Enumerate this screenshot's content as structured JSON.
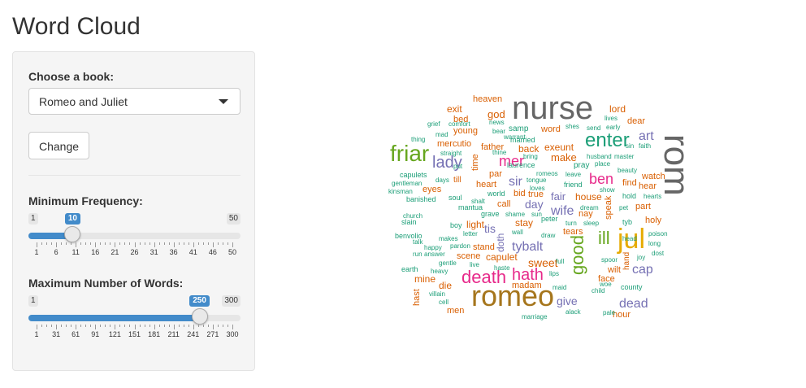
{
  "page_title": "Word Cloud",
  "sidebar": {
    "book_label": "Choose a book:",
    "book_selected": "Romeo and Juliet",
    "change_button": "Change",
    "min_freq": {
      "label": "Minimum Frequency:",
      "min": "1",
      "max": "50",
      "value": "10",
      "fraction": 0.184,
      "ticks": [
        "1",
        "6",
        "11",
        "16",
        "21",
        "26",
        "31",
        "36",
        "41",
        "46",
        "50"
      ]
    },
    "max_words": {
      "label": "Maximum Number of Words:",
      "min": "1",
      "max": "300",
      "value": "250",
      "fraction": 0.833,
      "ticks": [
        "1",
        "31",
        "61",
        "91",
        "121",
        "151",
        "181",
        "211",
        "241",
        "271",
        "300"
      ]
    }
  },
  "colors": {
    "accent": "#428bca",
    "grey": "#666666",
    "olive": "#66a61e",
    "orange": "#d95f02",
    "teal": "#1b9e77",
    "purple": "#7570b3",
    "magenta": "#e7298a",
    "gold": "#a6761d",
    "yellow": "#e6ab02"
  },
  "cloud_words": [
    {
      "t": "nurse",
      "s": 40,
      "c": "#666666"
    },
    {
      "t": "rom",
      "s": 44,
      "c": "#666666",
      "r": 90
    },
    {
      "t": "romeo",
      "s": 36,
      "c": "#a6761d"
    },
    {
      "t": "friar",
      "s": 28,
      "c": "#66a61e"
    },
    {
      "t": "enter",
      "s": 24,
      "c": "#1b9e77"
    },
    {
      "t": "jul",
      "s": 34,
      "c": "#e6ab02"
    },
    {
      "t": "death",
      "s": 22,
      "c": "#e7298a"
    },
    {
      "t": "lady",
      "s": 20,
      "c": "#7570b3"
    },
    {
      "t": "mer",
      "s": 18,
      "c": "#e7298a"
    },
    {
      "t": "good",
      "s": 22,
      "c": "#66a61e",
      "r": -90
    },
    {
      "t": "ill",
      "s": 22,
      "c": "#66a61e"
    },
    {
      "t": "hath",
      "s": 20,
      "c": "#e7298a"
    },
    {
      "t": "ben",
      "s": 18,
      "c": "#e7298a"
    },
    {
      "t": "art",
      "s": 16,
      "c": "#7570b3"
    },
    {
      "t": "sir",
      "s": 16,
      "c": "#7570b3"
    },
    {
      "t": "tybalt",
      "s": 16,
      "c": "#7570b3"
    },
    {
      "t": "wife",
      "s": 16,
      "c": "#7570b3"
    },
    {
      "t": "give",
      "s": 14,
      "c": "#7570b3"
    },
    {
      "t": "dead",
      "s": 16,
      "c": "#7570b3"
    },
    {
      "t": "cap",
      "s": 16,
      "c": "#7570b3"
    },
    {
      "t": "sweet",
      "s": 14,
      "c": "#d95f02"
    },
    {
      "t": "lord",
      "s": 12,
      "c": "#d95f02"
    },
    {
      "t": "dear",
      "s": 11,
      "c": "#d95f02"
    },
    {
      "t": "god",
      "s": 13,
      "c": "#d95f02"
    },
    {
      "t": "exit",
      "s": 12,
      "c": "#d95f02"
    },
    {
      "t": "heaven",
      "s": 11,
      "c": "#d95f02"
    },
    {
      "t": "bed",
      "s": 11,
      "c": "#d95f02"
    },
    {
      "t": "young",
      "s": 11,
      "c": "#d95f02"
    },
    {
      "t": "word",
      "s": 11,
      "c": "#d95f02"
    },
    {
      "t": "exeunt",
      "s": 12,
      "c": "#d95f02"
    },
    {
      "t": "make",
      "s": 13,
      "c": "#d95f02"
    },
    {
      "t": "back",
      "s": 12,
      "c": "#d95f02"
    },
    {
      "t": "father",
      "s": 11,
      "c": "#d95f02"
    },
    {
      "t": "mercutio",
      "s": 11,
      "c": "#d95f02"
    },
    {
      "t": "time",
      "s": 11,
      "c": "#d95f02",
      "r": -90
    },
    {
      "t": "heart",
      "s": 11,
      "c": "#d95f02"
    },
    {
      "t": "par",
      "s": 11,
      "c": "#d95f02"
    },
    {
      "t": "eyes",
      "s": 11,
      "c": "#d95f02"
    },
    {
      "t": "day",
      "s": 14,
      "c": "#7570b3"
    },
    {
      "t": "fair",
      "s": 13,
      "c": "#7570b3"
    },
    {
      "t": "house",
      "s": 12,
      "c": "#d95f02"
    },
    {
      "t": "call",
      "s": 11,
      "c": "#d95f02"
    },
    {
      "t": "stay",
      "s": 12,
      "c": "#d95f02"
    },
    {
      "t": "light",
      "s": 12,
      "c": "#d95f02"
    },
    {
      "t": "stand",
      "s": 11,
      "c": "#d95f02"
    },
    {
      "t": "capulet",
      "s": 12,
      "c": "#d95f02"
    },
    {
      "t": "scene",
      "s": 11,
      "c": "#d95f02"
    },
    {
      "t": "mine",
      "s": 12,
      "c": "#d95f02"
    },
    {
      "t": "die",
      "s": 12,
      "c": "#d95f02"
    },
    {
      "t": "men",
      "s": 11,
      "c": "#d95f02"
    },
    {
      "t": "madam",
      "s": 11,
      "c": "#d95f02"
    },
    {
      "t": "watch",
      "s": 11,
      "c": "#d95f02"
    },
    {
      "t": "hear",
      "s": 11,
      "c": "#d95f02"
    },
    {
      "t": "find",
      "s": 11,
      "c": "#d95f02"
    },
    {
      "t": "part",
      "s": 11,
      "c": "#d95f02"
    },
    {
      "t": "holy",
      "s": 11,
      "c": "#d95f02"
    },
    {
      "t": "wilt",
      "s": 11,
      "c": "#d95f02"
    },
    {
      "t": "face",
      "s": 11,
      "c": "#d95f02"
    },
    {
      "t": "hour",
      "s": 11,
      "c": "#d95f02"
    },
    {
      "t": "hast",
      "s": 11,
      "c": "#d95f02",
      "r": -90
    },
    {
      "t": "tears",
      "s": 11,
      "c": "#d95f02"
    },
    {
      "t": "true",
      "s": 11,
      "c": "#d95f02"
    },
    {
      "t": "bid",
      "s": 11,
      "c": "#d95f02"
    },
    {
      "t": "till",
      "s": 10,
      "c": "#d95f02"
    },
    {
      "t": "tis",
      "s": 14,
      "c": "#7570b3"
    },
    {
      "t": "doth",
      "s": 12,
      "c": "#7570b3",
      "r": -90
    },
    {
      "t": "nay",
      "s": 11,
      "c": "#d95f02"
    },
    {
      "t": "speak",
      "s": 11,
      "c": "#d95f02",
      "r": -90
    },
    {
      "t": "hand",
      "s": 10,
      "c": "#d95f02",
      "r": -90
    },
    {
      "t": "samp",
      "s": 10,
      "c": "#1b9e77"
    },
    {
      "t": "shes",
      "s": 8,
      "c": "#1b9e77"
    },
    {
      "t": "grief",
      "s": 8,
      "c": "#1b9e77"
    },
    {
      "t": "comfort",
      "s": 8,
      "c": "#1b9e77"
    },
    {
      "t": "mad",
      "s": 8,
      "c": "#1b9e77"
    },
    {
      "t": "thing",
      "s": 8,
      "c": "#1b9e77"
    },
    {
      "t": "married",
      "s": 9,
      "c": "#1b9e77"
    },
    {
      "t": "lives",
      "s": 8,
      "c": "#1b9e77"
    },
    {
      "t": "send",
      "s": 8,
      "c": "#1b9e77"
    },
    {
      "t": "early",
      "s": 8,
      "c": "#1b9e77"
    },
    {
      "t": "sin",
      "s": 8,
      "c": "#1b9e77"
    },
    {
      "t": "faith",
      "s": 8,
      "c": "#1b9e77"
    },
    {
      "t": "news",
      "s": 8,
      "c": "#1b9e77"
    },
    {
      "t": "bear",
      "s": 8,
      "c": "#1b9e77"
    },
    {
      "t": "warrant",
      "s": 8,
      "c": "#1b9e77"
    },
    {
      "t": "thine",
      "s": 8,
      "c": "#1b9e77"
    },
    {
      "t": "straight",
      "s": 8,
      "c": "#1b9e77"
    },
    {
      "t": "bring",
      "s": 8,
      "c": "#1b9e77"
    },
    {
      "t": "pray",
      "s": 10,
      "c": "#1b9e77"
    },
    {
      "t": "laurence",
      "s": 9,
      "c": "#1b9e77"
    },
    {
      "t": "husband",
      "s": 8,
      "c": "#1b9e77"
    },
    {
      "t": "master",
      "s": 8,
      "c": "#1b9e77"
    },
    {
      "t": "place",
      "s": 8,
      "c": "#1b9e77"
    },
    {
      "t": "beauty",
      "s": 8,
      "c": "#1b9e77"
    },
    {
      "t": "put",
      "s": 8,
      "c": "#1b9e77"
    },
    {
      "t": "romeos",
      "s": 8,
      "c": "#1b9e77"
    },
    {
      "t": "leave",
      "s": 8,
      "c": "#1b9e77"
    },
    {
      "t": "tongue",
      "s": 8,
      "c": "#1b9e77"
    },
    {
      "t": "friend",
      "s": 9,
      "c": "#1b9e77"
    },
    {
      "t": "capulets",
      "s": 9,
      "c": "#1b9e77"
    },
    {
      "t": "days",
      "s": 8,
      "c": "#1b9e77"
    },
    {
      "t": "gentleman",
      "s": 8,
      "c": "#1b9e77"
    },
    {
      "t": "kinsman",
      "s": 8,
      "c": "#1b9e77"
    },
    {
      "t": "banished",
      "s": 9,
      "c": "#1b9e77"
    },
    {
      "t": "soul",
      "s": 9,
      "c": "#1b9e77"
    },
    {
      "t": "shalt",
      "s": 8,
      "c": "#1b9e77"
    },
    {
      "t": "loves",
      "s": 8,
      "c": "#1b9e77"
    },
    {
      "t": "show",
      "s": 8,
      "c": "#1b9e77"
    },
    {
      "t": "hold",
      "s": 9,
      "c": "#1b9e77"
    },
    {
      "t": "hearts",
      "s": 8,
      "c": "#1b9e77"
    },
    {
      "t": "pet",
      "s": 8,
      "c": "#1b9e77"
    },
    {
      "t": "mantua",
      "s": 9,
      "c": "#1b9e77"
    },
    {
      "t": "world",
      "s": 9,
      "c": "#1b9e77"
    },
    {
      "t": "grave",
      "s": 9,
      "c": "#1b9e77"
    },
    {
      "t": "shame",
      "s": 8,
      "c": "#1b9e77"
    },
    {
      "t": "sun",
      "s": 8,
      "c": "#1b9e77"
    },
    {
      "t": "dream",
      "s": 8,
      "c": "#1b9e77"
    },
    {
      "t": "slain",
      "s": 9,
      "c": "#1b9e77"
    },
    {
      "t": "church",
      "s": 8,
      "c": "#1b9e77"
    },
    {
      "t": "boy",
      "s": 9,
      "c": "#1b9e77"
    },
    {
      "t": "peter",
      "s": 9,
      "c": "#1b9e77"
    },
    {
      "t": "turn",
      "s": 8,
      "c": "#1b9e77"
    },
    {
      "t": "sleep",
      "s": 8,
      "c": "#1b9e77"
    },
    {
      "t": "tyb",
      "s": 9,
      "c": "#1b9e77"
    },
    {
      "t": "benvolio",
      "s": 9,
      "c": "#1b9e77"
    },
    {
      "t": "letter",
      "s": 8,
      "c": "#1b9e77"
    },
    {
      "t": "wall",
      "s": 8,
      "c": "#1b9e77"
    },
    {
      "t": "draw",
      "s": 8,
      "c": "#1b9e77"
    },
    {
      "t": "head",
      "s": 8,
      "c": "#1b9e77"
    },
    {
      "t": "poison",
      "s": 8,
      "c": "#1b9e77"
    },
    {
      "t": "talk",
      "s": 8,
      "c": "#1b9e77"
    },
    {
      "t": "makes",
      "s": 8,
      "c": "#1b9e77"
    },
    {
      "t": "happy",
      "s": 8,
      "c": "#1b9e77"
    },
    {
      "t": "pardon",
      "s": 8,
      "c": "#1b9e77"
    },
    {
      "t": "long",
      "s": 8,
      "c": "#1b9e77"
    },
    {
      "t": "run",
      "s": 8,
      "c": "#1b9e77"
    },
    {
      "t": "answer",
      "s": 8,
      "c": "#1b9e77"
    },
    {
      "t": "full",
      "s": 8,
      "c": "#1b9e77"
    },
    {
      "t": "spoor",
      "s": 8,
      "c": "#1b9e77"
    },
    {
      "t": "joy",
      "s": 8,
      "c": "#1b9e77"
    },
    {
      "t": "dost",
      "s": 8,
      "c": "#1b9e77"
    },
    {
      "t": "earth",
      "s": 9,
      "c": "#1b9e77"
    },
    {
      "t": "gentle",
      "s": 8,
      "c": "#1b9e77"
    },
    {
      "t": "live",
      "s": 8,
      "c": "#1b9e77"
    },
    {
      "t": "heavy",
      "s": 8,
      "c": "#1b9e77"
    },
    {
      "t": "haste",
      "s": 8,
      "c": "#1b9e77"
    },
    {
      "t": "lips",
      "s": 8,
      "c": "#1b9e77"
    },
    {
      "t": "maid",
      "s": 8,
      "c": "#1b9e77"
    },
    {
      "t": "villain",
      "s": 8,
      "c": "#1b9e77"
    },
    {
      "t": "cell",
      "s": 8,
      "c": "#1b9e77"
    },
    {
      "t": "child",
      "s": 8,
      "c": "#1b9e77"
    },
    {
      "t": "county",
      "s": 9,
      "c": "#1b9e77"
    },
    {
      "t": "woe",
      "s": 8,
      "c": "#1b9e77"
    },
    {
      "t": "alack",
      "s": 8,
      "c": "#1b9e77"
    },
    {
      "t": "pale",
      "s": 8,
      "c": "#1b9e77"
    },
    {
      "t": "marriage",
      "s": 8,
      "c": "#1b9e77"
    }
  ]
}
